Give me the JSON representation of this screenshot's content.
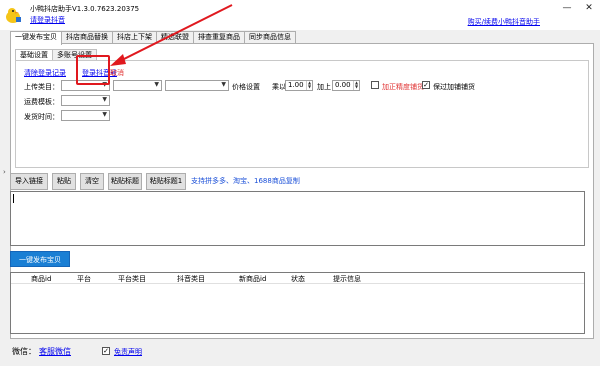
{
  "app": {
    "title": "小鸭抖店助手V1.3.0.7623.20375",
    "login_link": "请登录抖音",
    "buy_link": "购买/续费小鸭抖音助手",
    "window_controls": {
      "minimize": "—",
      "close": "✕"
    }
  },
  "main_tabs": [
    {
      "label": "一键发布宝贝",
      "active": true
    },
    {
      "label": "抖店商品替换"
    },
    {
      "label": "抖店上下架"
    },
    {
      "label": "精选联盟"
    },
    {
      "label": "排查重复商品"
    },
    {
      "label": "同步商品信息"
    }
  ],
  "sub_tabs": [
    {
      "label": "基础设置",
      "active": true
    },
    {
      "label": "多账号设置"
    }
  ],
  "settings": {
    "clear_records_link": "清除登录记录",
    "login_records_link": "登录抖音号",
    "cancel_link": "取消",
    "category_label": "上传类目：",
    "price_label": "价格设置",
    "multiply_label": "乘以",
    "multiply_value": "1.00",
    "add_label": "加上",
    "add_value": "0.00",
    "decimal_label": "加正精度铺货",
    "discount_label": "保过加铺铺货",
    "freight_label": "运费模板：",
    "ship_label": "发货时间：",
    "decimal_checked": false,
    "discount_checked": true
  },
  "toolbar": {
    "import_label": "导入链接",
    "paste_label": "粘贴",
    "clear_label": "清空",
    "paste_title_label": "粘贴标题",
    "paste_title2_label": "粘贴标题1",
    "support_text": "支持拼多多、淘宝、1688商品复制"
  },
  "publish_button": "一键发布宝贝",
  "table": {
    "columns": [
      "商品id",
      "平台",
      "平台类目",
      "抖音类目",
      "新商品id",
      "状态",
      "提示信息"
    ]
  },
  "footer": {
    "wechat_label": "微信：",
    "service_link": "客服微信",
    "disclaimer_label": "免责声明",
    "disclaimer_checked": true
  },
  "colors": {
    "accent": "#1a7fd4",
    "highlight": "#e0181e",
    "link": "#0000ee"
  }
}
